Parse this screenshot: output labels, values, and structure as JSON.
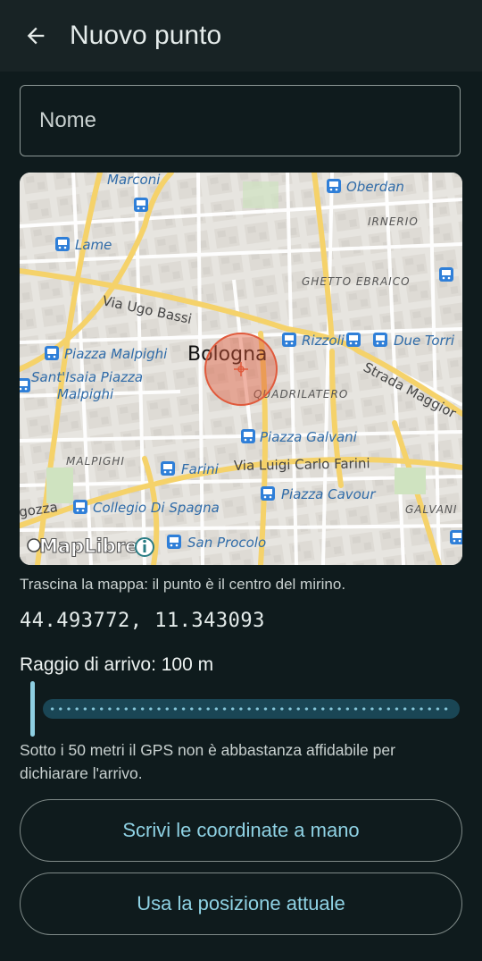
{
  "app_bar": {
    "title": "Nuovo punto",
    "back_icon": "arrow-back-icon"
  },
  "name_field": {
    "placeholder": "Nome",
    "value": ""
  },
  "map": {
    "city_label": "Bologna",
    "attribution": "MapLibre",
    "labels": {
      "marconi": "Marconi",
      "oberdan": "Oberdan",
      "irnerio": "IRNERIO",
      "lame": "Lame",
      "ghetto_ebraico": "GHETTO EBRAICO",
      "via_ugo_bassi": "Via Ugo Bassi",
      "rizzoli": "Rizzoli",
      "due_torri": "Due Torri",
      "piazza_malpighi": "Piazza Malpighi",
      "santisaia_1": "Sant'Isaia Piazza",
      "santisaia_2": "Malpighi",
      "quadrilatero": "QUADRILATERO",
      "strada_maggiore": "Strada Maggior",
      "piazza_galvani": "Piazza Galvani",
      "malpighi": "MALPIGHI",
      "farini": "Farini",
      "via_luigi_carlo_farini": "Via Luigi Carlo Farini",
      "piazza_cavour": "Piazza Cavour",
      "saragozza": "gozza",
      "collegio_di_spagna": "Collegio Di Spagna",
      "galvani": "GALVANI",
      "san_procolo": "San Procolo"
    },
    "colors": {
      "crosshair": "#e05a3c",
      "bus_stop": "#2f7fd8",
      "main_road": "#f5d26a"
    }
  },
  "hint": "Trascina la mappa: il punto è il centro del mirino.",
  "coordinates": "44.493772, 11.343093",
  "radius": {
    "label": "Raggio di arrivo: 100 m",
    "value_m": 100
  },
  "note": "Sotto i 50 metri il GPS non è abbastanza affidabile per dichiarare l'arrivo.",
  "buttons": {
    "manual": "Scrivi le coordinate a mano",
    "current": "Usa la posizione attuale"
  }
}
